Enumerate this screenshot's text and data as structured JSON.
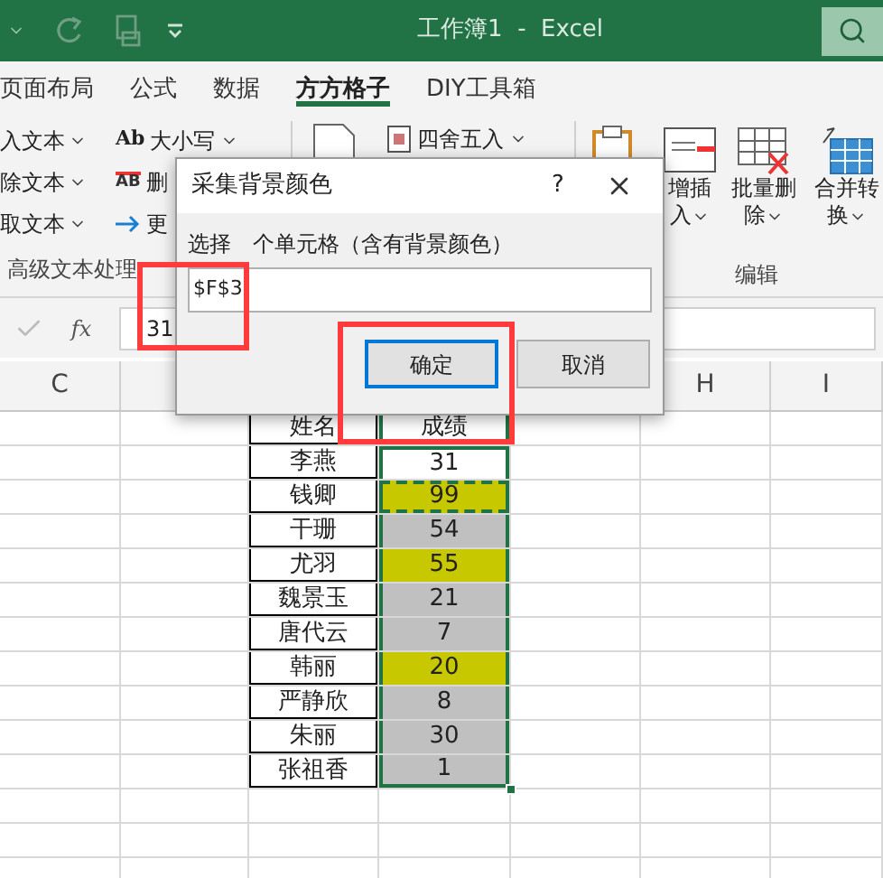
{
  "title_bar": {
    "title": "工作簿1  -  Excel"
  },
  "tabs": [
    {
      "label": "页面布局",
      "selected": false
    },
    {
      "label": "公式",
      "selected": false
    },
    {
      "label": "数据",
      "selected": false
    },
    {
      "label": "方方格子",
      "selected": true
    },
    {
      "label": "DIY工具箱",
      "selected": false
    }
  ],
  "ribbon": {
    "text_items": [
      {
        "label": "入文本"
      },
      {
        "label": "除文本"
      },
      {
        "label": "取文本"
      }
    ],
    "case_button": {
      "icon_text": "Ab",
      "label": "大小写"
    },
    "delete_button": {
      "icon_text": "AB",
      "label": "删"
    },
    "more_button": {
      "label": "更"
    },
    "text_group_label": "高级文本处理",
    "round_button": {
      "label": "四舍五入"
    },
    "edit_buttons": [
      {
        "lines": [
          "增插",
          "入"
        ]
      },
      {
        "lines": [
          "批量删",
          "除"
        ]
      },
      {
        "lines": [
          "合并转",
          "换"
        ]
      }
    ],
    "edit_group_label": "编辑"
  },
  "formula_bar": {
    "fx": "fx",
    "value": "31"
  },
  "column_headers": [
    {
      "label": "C"
    },
    {
      "label": "H"
    },
    {
      "label": "I"
    }
  ],
  "table": {
    "header": [
      "姓名",
      "成绩"
    ],
    "rows": [
      {
        "name": "李燕",
        "score": "31",
        "color": "#ffffff",
        "copied": false
      },
      {
        "name": "钱卿",
        "score": "99",
        "color": "#c8c800",
        "copied": true
      },
      {
        "name": "干珊",
        "score": "54",
        "color": "#c0c0c0",
        "copied": false
      },
      {
        "name": "尤羽",
        "score": "55",
        "color": "#c8c800",
        "copied": false
      },
      {
        "name": "魏景玉",
        "score": "21",
        "color": "#c0c0c0",
        "copied": false
      },
      {
        "name": "唐代云",
        "score": "7",
        "color": "#c0c0c0",
        "copied": false
      },
      {
        "name": "韩丽",
        "score": "20",
        "color": "#c8c800",
        "copied": false
      },
      {
        "name": "严静欣",
        "score": "8",
        "color": "#c0c0c0",
        "copied": false
      },
      {
        "name": "朱丽",
        "score": "30",
        "color": "#c0c0c0",
        "copied": false
      },
      {
        "name": "张祖香",
        "score": "1",
        "color": "#c0c0c0",
        "copied": false
      }
    ]
  },
  "dialog": {
    "title": "采集背景颜色",
    "help": "?",
    "prompt": [
      "选择",
      "个单元格（含有背景颜色）"
    ],
    "value": "$F$3",
    "buttons": [
      {
        "label": "确定",
        "default": true
      },
      {
        "label": "取消",
        "default": false
      }
    ]
  }
}
